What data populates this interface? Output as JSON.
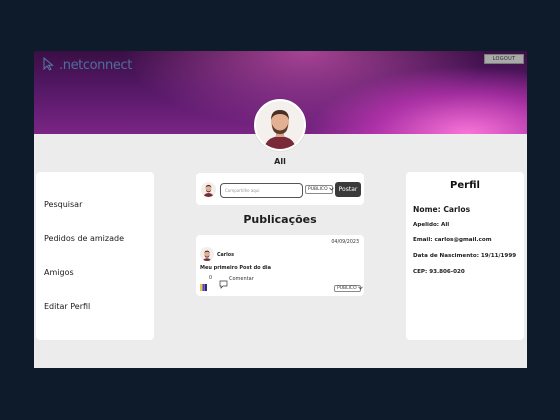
{
  "header": {
    "brand": ".netconnect",
    "logout_label": "LOGOUT"
  },
  "profile": {
    "name": "All"
  },
  "sidebar": {
    "items": [
      {
        "label": "Pesquisar"
      },
      {
        "label": "Pedidos de amizade"
      },
      {
        "label": "Amigos"
      },
      {
        "label": "Editar Perfil"
      }
    ]
  },
  "composer": {
    "placeholder": "Compartilhe aqui",
    "visibility": "PUBLICO",
    "post_label": "Postar"
  },
  "feed": {
    "title": "Publicações",
    "posts": [
      {
        "date": "04/09/2023",
        "author": "Carlos",
        "text": "Meu primeiro Post do dia",
        "likes": "0",
        "comment_label": "Comentar",
        "visibility": "PUBLICO"
      }
    ]
  },
  "profile_panel": {
    "title": "Perfil",
    "name": "Nome: Carlos",
    "nickname": "Apelido: All",
    "email": "Email: carlos@gmail.com",
    "birth": "Data de Nascimento: 19/11/1999",
    "cep": "CEP: 93.806-020"
  },
  "colors": {
    "page_bg": "#0e1b2a",
    "banner": "#541866",
    "accent_pink": "#e05ad0",
    "brand": "#4e6f9c"
  },
  "icons": [
    "cursor-logo-icon",
    "like-icon",
    "comment-icon",
    "chevron-down-icon"
  ]
}
